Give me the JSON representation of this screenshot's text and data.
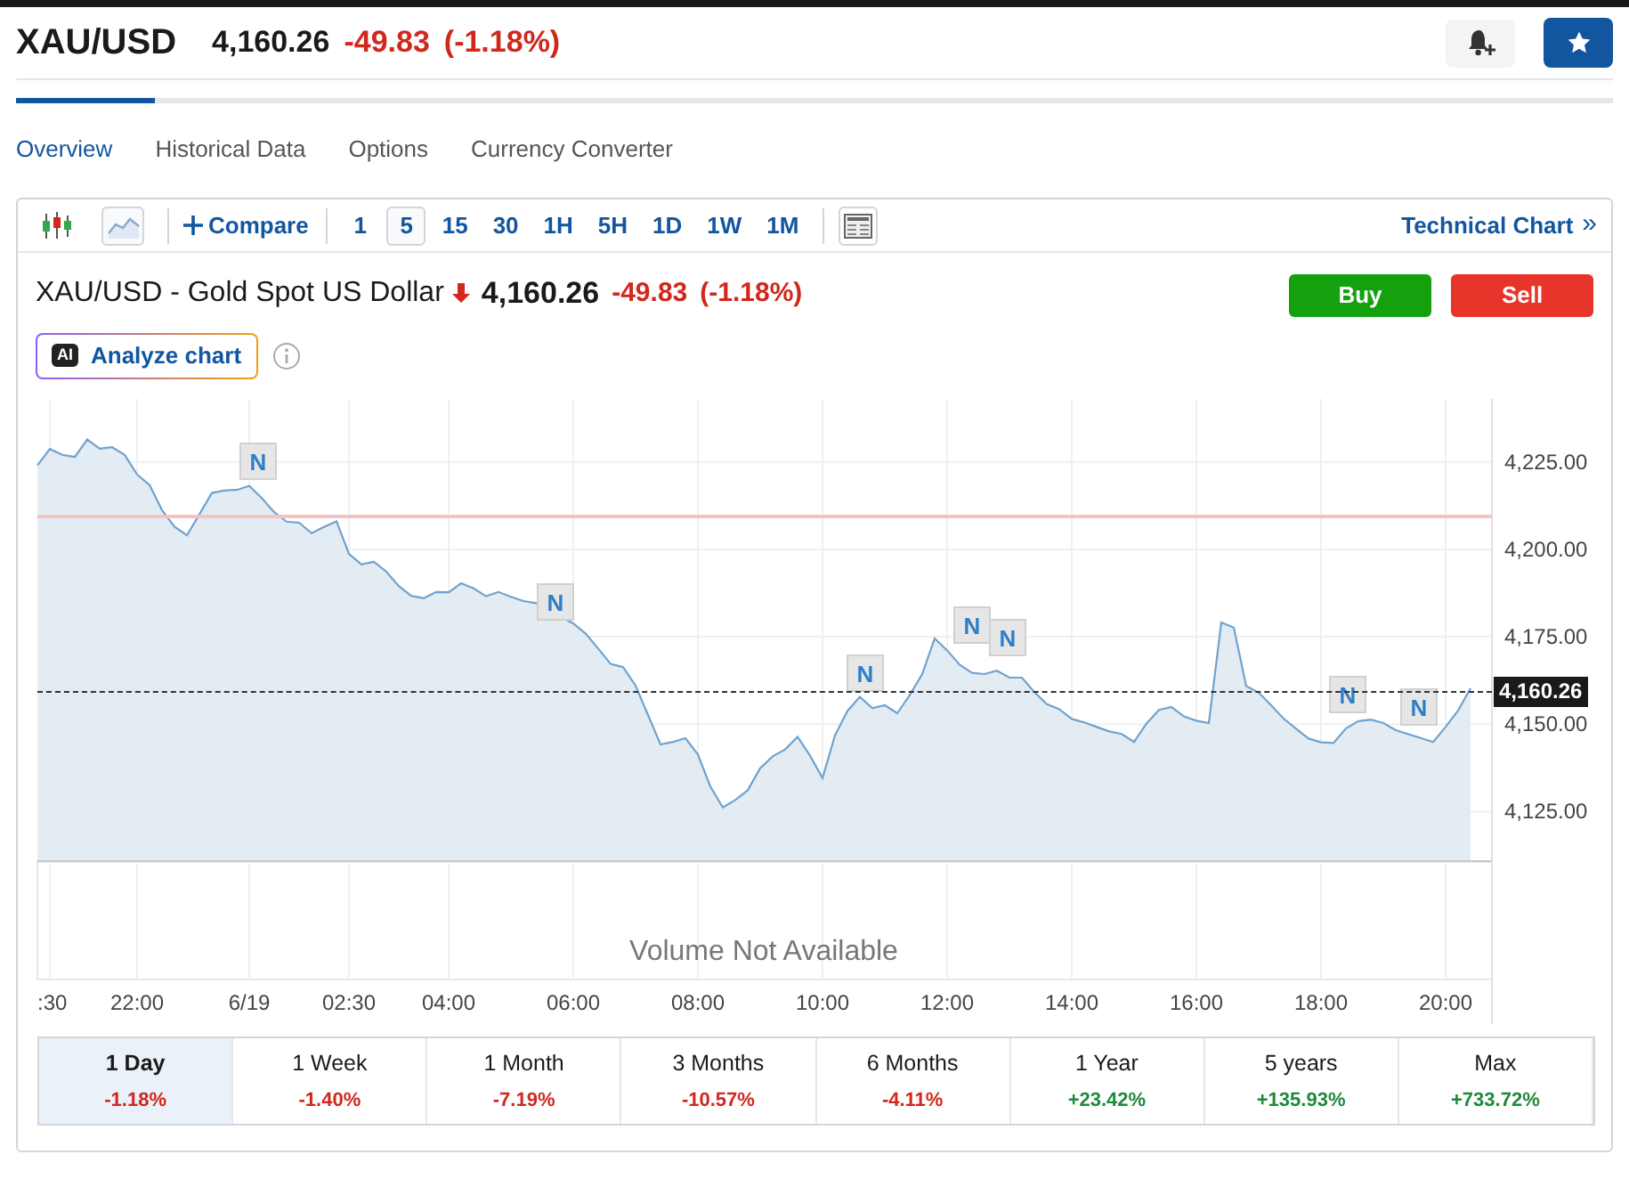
{
  "header": {
    "symbol": "XAU/USD",
    "price": "4,160.26",
    "change": "-49.83",
    "change_percent": "(-1.18%)",
    "color": "#d0281c",
    "alert_on": false,
    "watchlisted": true
  },
  "tabs": [
    {
      "label": "Overview",
      "selected": true
    },
    {
      "label": "Historical Data",
      "selected": false
    },
    {
      "label": "Options",
      "selected": false
    },
    {
      "label": "Currency Converter",
      "selected": false
    }
  ],
  "toolbar": {
    "chart_types": [
      {
        "kind": "candles",
        "selected": false
      },
      {
        "kind": "area",
        "selected": true
      }
    ],
    "compare": "Compare",
    "intervals": [
      {
        "label": "1",
        "selected": false
      },
      {
        "label": "5",
        "selected": true
      },
      {
        "label": "15",
        "selected": false
      },
      {
        "label": "30",
        "selected": false
      },
      {
        "label": "1H",
        "selected": false
      },
      {
        "label": "5H",
        "selected": false
      },
      {
        "label": "1D",
        "selected": false
      },
      {
        "label": "1W",
        "selected": false
      },
      {
        "label": "1M",
        "selected": false
      }
    ],
    "technical_chart": "Technical Chart",
    "technical_chart_arrow": "»"
  },
  "quote": {
    "title": "XAU/USD - Gold Spot US Dollar",
    "price": "4,160.26",
    "change": "-49.83",
    "change_percent": "(-1.18%)",
    "color": "#d0281c",
    "buy": "Buy",
    "sell": "Sell",
    "ai_badge": "AI",
    "analyze": "Analyze chart"
  },
  "chart": {
    "volume_note": "Volume Not Available",
    "current_price_label": "4,160.26",
    "news_markers": [
      {
        "text": "N"
      },
      {
        "text": "N"
      },
      {
        "text": "N"
      },
      {
        "text": "N"
      },
      {
        "text": "N"
      },
      {
        "text": "N"
      },
      {
        "text": "N"
      }
    ],
    "chart_data": {
      "type": "area",
      "grid": true,
      "ylim": [
        4064,
        4243
      ],
      "categories": [
        null,
        ":30",
        null,
        null,
        null,
        null,
        null,
        null,
        "22:00",
        null,
        null,
        null,
        null,
        null,
        null,
        null,
        null,
        "6/19",
        null,
        null,
        null,
        null,
        null,
        null,
        null,
        "02:30",
        null,
        null,
        null,
        null,
        null,
        null,
        null,
        "04:00",
        null,
        null,
        null,
        null,
        null,
        null,
        null,
        null,
        null,
        "06:00",
        null,
        null,
        null,
        null,
        null,
        null,
        null,
        null,
        null,
        "08:00",
        null,
        null,
        null,
        null,
        null,
        null,
        null,
        null,
        null,
        "10:00",
        null,
        null,
        null,
        null,
        null,
        null,
        null,
        null,
        null,
        "12:00",
        null,
        null,
        null,
        null,
        null,
        null,
        null,
        null,
        null,
        "14:00",
        null,
        null,
        null,
        null,
        null,
        null,
        null,
        null,
        null,
        "16:00",
        null,
        null,
        null,
        null,
        null,
        null,
        null,
        null,
        null,
        "18:00",
        null,
        null,
        null,
        null,
        null,
        null,
        null,
        null,
        null,
        "20:00",
        null,
        null
      ],
      "yticks": [
        {
          "value": 4125,
          "label": "4,125.00"
        },
        {
          "value": 4150,
          "label": "4,150.00"
        },
        {
          "value": 4175,
          "label": "4,175.00"
        },
        {
          "value": 4200,
          "label": "4,200.00"
        },
        {
          "value": 4225,
          "label": "4,225.00"
        }
      ],
      "series": [
        {
          "color": "#6fa3d0",
          "values": [
            4224.0,
            4228.7,
            4227.0,
            4226.4,
            4231.4,
            4228.8,
            4229.2,
            4227.0,
            4221.4,
            4218.4,
            4211.2,
            4206.5,
            4204.0,
            4210.0,
            4216.1,
            4216.8,
            4217.0,
            4218.1,
            4214.7,
            4210.6,
            4207.9,
            4207.6,
            4204.6,
            4206.4,
            4208.0,
            4198.7,
            4195.7,
            4196.4,
            4193.6,
            4189.5,
            4186.7,
            4186.0,
            4187.8,
            4187.7,
            4190.3,
            4188.8,
            4186.6,
            4187.8,
            4186.4,
            4185.2,
            4184.6,
            null,
            null,
            4178.8,
            4175.9,
            4171.6,
            4167.2,
            4166.3,
            4161.0,
            4152.6,
            4144.2,
            4144.9,
            4146.0,
            4141.3,
            4132.2,
            4126.2,
            4128.3,
            4131.1,
            4137.4,
            4140.8,
            4142.8,
            4146.4,
            4141.0,
            4134.6,
            4146.8,
            4153.8,
            4157.8,
            4154.6,
            4155.4,
            4153.1,
            4158.3,
            4164.3,
            4174.5,
            4171.1,
            4167.0,
            4164.7,
            4164.3,
            4165.3,
            4163.3,
            4163.3,
            4159.2,
            4155.7,
            4154.3,
            4151.5,
            4150.5,
            4149.2,
            4147.9,
            4147.2,
            4144.9,
            4150.2,
            4154.1,
            4154.9,
            4152.2,
            4151.0,
            4150.3,
            4179.1,
            4177.6,
            4160.9,
            4159.0,
            4155.4,
            4151.6,
            4148.7,
            4145.9,
            4144.8,
            4144.6,
            4148.8,
            4150.9,
            4151.3,
            4150.3,
            4148.3,
            null,
            null,
            4144.9,
            4149.2,
            4153.9,
            4160.3
          ]
        }
      ]
    }
  },
  "periods": [
    {
      "label": "1 Day",
      "change": "-1.18%",
      "color": "#d0281c",
      "selected": true
    },
    {
      "label": "1 Week",
      "change": "-1.40%",
      "color": "#d0281c",
      "selected": false
    },
    {
      "label": "1 Month",
      "change": "-7.19%",
      "color": "#d0281c",
      "selected": false
    },
    {
      "label": "3 Months",
      "change": "-10.57%",
      "color": "#d0281c",
      "selected": false
    },
    {
      "label": "6 Months",
      "change": "-4.11%",
      "color": "#d0281c",
      "selected": false
    },
    {
      "label": "1 Year",
      "change": "+23.42%",
      "color": "#1e8a3c",
      "selected": false
    },
    {
      "label": "5 years",
      "change": "+135.93%",
      "color": "#1e8a3c",
      "selected": false
    },
    {
      "label": "Max",
      "change": "+733.72%",
      "color": "#1e8a3c",
      "selected": false
    }
  ]
}
